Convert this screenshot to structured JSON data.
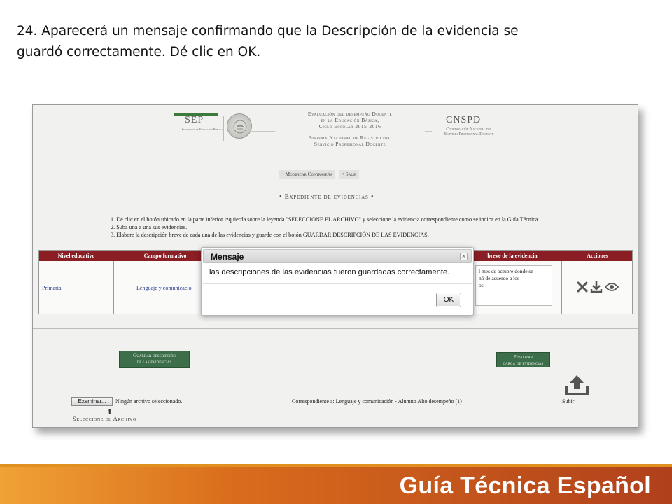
{
  "instruction": {
    "line1": "24. Aparecerá un mensaje confirmando que la Descripción de la evidencia se",
    "line2": "guardó correctamente. Dé clic en OK."
  },
  "header": {
    "sep_title": "SEP",
    "sep_subtitle": "Secretaría de Educación Pública",
    "eval_lines": [
      "Evaluación del desempeño Docente",
      "en la Educación Básica,",
      "Ciclo Escolar 2015-2016"
    ],
    "sistema_lines": [
      "Sistema Nacional de Registro del",
      "Servicio Profesional Docente"
    ],
    "cnspd_title": "CNSPD",
    "cnspd_lines": [
      "Coordinación Nacional del",
      "Servicio Profesional Docente"
    ]
  },
  "top_menu": {
    "change_password": "• Modificar Contraseña",
    "logout": "• Salir"
  },
  "page_title": "• Expediente de evidencias •",
  "steps": [
    "1. Dé clic en el botón ubicado en la parte inferior izquierda sobre la leyenda \"SELECCIONE EL ARCHIVO\" y seleccione la evidencia correspondiente como se indica en la Guía Técnica.",
    "2. Suba una a una sus evidencias.",
    "3. Elabore la descripción breve de cada una de las evidencias y guarde con el botón GUARDAR DESCRIPCIÓN DE LAS EVIDENCIAS."
  ],
  "table": {
    "headers": {
      "nivel": "Nivel educativo",
      "campo": "Campo formativo",
      "descripcion": "breve de la evidencia",
      "acciones": "Acciones"
    },
    "row": {
      "nivel": "Primaria",
      "campo": "Lenguaje y comunicació",
      "descripcion_lines": [
        "l mes de octubre donde se",
        "nó de acuerdo a los",
        "os"
      ]
    }
  },
  "buttons": {
    "guardar_line1": "Guardar descripción",
    "guardar_line2": "de las evidencias",
    "finalizar_line1": "Finalizar",
    "finalizar_line2": "carga de evidencias",
    "subir": "Subir",
    "examinar": "Examinar...",
    "ok": "OK"
  },
  "file": {
    "no_file": "Ningún archivo seleccionado.",
    "correspondiente": "Correspondiente a: Lenguaje y comunicación - Alumno Alto desempeño (1)",
    "seleccione": "Seleccione el Archivo"
  },
  "modal": {
    "title": "Mensaje",
    "close": "×",
    "message": "las descripciones de las evidencias fueron guardadas correctamente."
  },
  "footer": {
    "text": "Guía Técnica Español"
  },
  "colors": {
    "table_header": "#8b1d24",
    "green_button": "#3d6e4a",
    "footer_orange": "#d96c1c"
  }
}
